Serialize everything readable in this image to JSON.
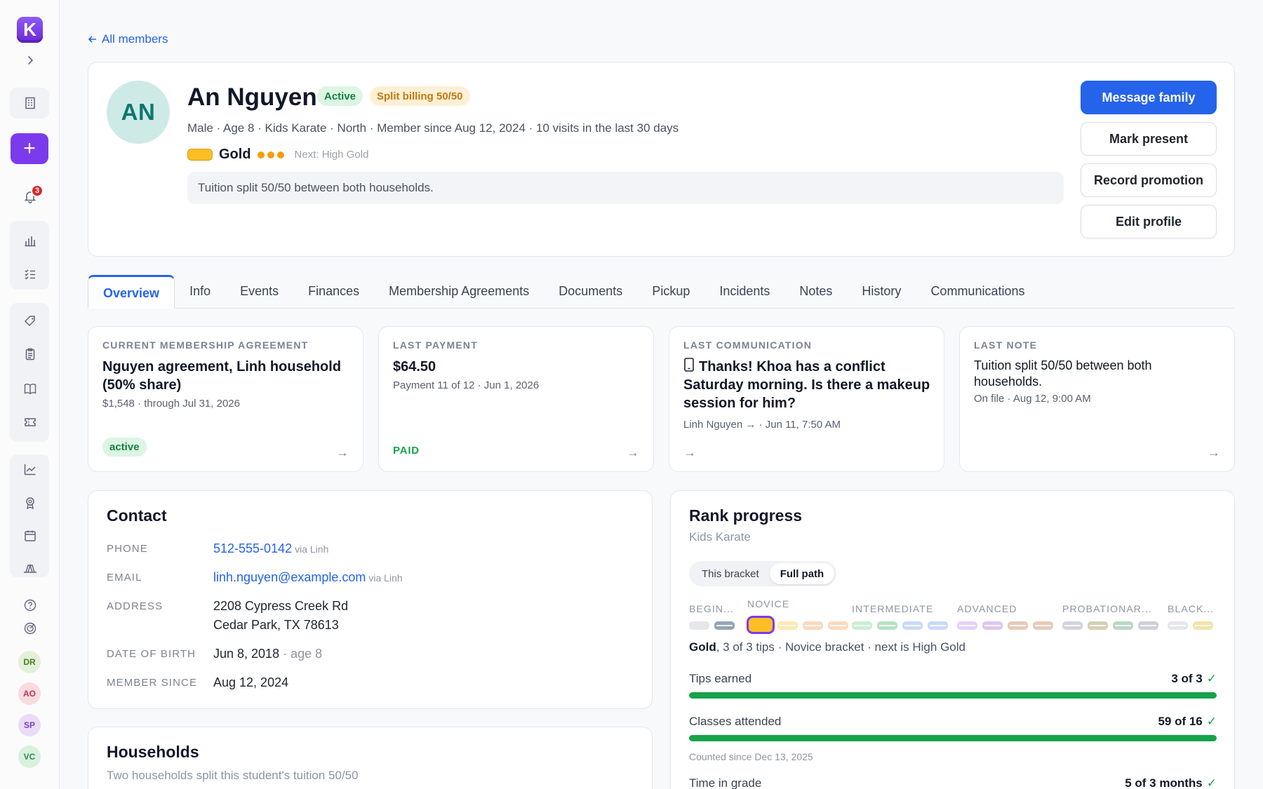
{
  "sidebar": {
    "logo_letter": "K",
    "notifications_count": "3",
    "avatars": [
      {
        "initials": "DR",
        "bg": "#e1f2d8",
        "fg": "#4d7c2a"
      },
      {
        "initials": "AO",
        "bg": "#f9dbe0",
        "fg": "#be3450"
      },
      {
        "initials": "SP",
        "bg": "#eadcf8",
        "fg": "#7e3fc4"
      },
      {
        "initials": "VC",
        "bg": "#d9f1df",
        "fg": "#2f8a4a"
      }
    ]
  },
  "back_link": "All members",
  "profile": {
    "initials": "AN",
    "name": "An Nguyen",
    "status": "Active",
    "billing": "Split billing 50/50",
    "meta": "Male · Age 8 · Kids Karate · North · Member since Aug 12, 2024 · 10 visits in the last 30 days",
    "rank": "Gold",
    "rank_stripes": 3,
    "next_rank": "Next: High Gold",
    "note": "Tuition split 50/50 between both households.",
    "actions": {
      "message": "Message family",
      "present": "Mark present",
      "promotion": "Record promotion",
      "edit": "Edit profile"
    }
  },
  "tabs": [
    "Overview",
    "Info",
    "Events",
    "Finances",
    "Membership Agreements",
    "Documents",
    "Pickup",
    "Incidents",
    "Notes",
    "History",
    "Communications"
  ],
  "summary": {
    "agreement": {
      "label": "CURRENT MEMBERSHIP AGREEMENT",
      "title": "Nguyen agreement, Linh household (50% share)",
      "sub": "$1,548 · through Jul 31, 2026",
      "status": "active"
    },
    "payment": {
      "label": "LAST PAYMENT",
      "title": "$64.50",
      "sub": "Payment 11 of 12 · Jun 1, 2026",
      "status": "PAID"
    },
    "communication": {
      "label": "LAST COMMUNICATION",
      "title": "Thanks! Khoa has a conflict Saturday morning. Is there a makeup session for him?",
      "sub": "Linh Nguyen → · Jun 11, 7:50 AM"
    },
    "note": {
      "label": "LAST NOTE",
      "title": "Tuition split 50/50 between both households.",
      "sub": "On file · Aug 12, 9:00 AM"
    }
  },
  "contact": {
    "title": "Contact",
    "phone_label": "PHONE",
    "phone": "512-555-0142",
    "phone_via": "via Linh",
    "email_label": "EMAIL",
    "email": "linh.nguyen@example.com",
    "email_via": "via Linh",
    "address_label": "ADDRESS",
    "address_line1": "2208 Cypress Creek Rd",
    "address_line2": "Cedar Park, TX 78613",
    "dob_label": "DATE OF BIRTH",
    "dob": "Jun 8, 2018",
    "dob_age": "· age 8",
    "since_label": "MEMBER SINCE",
    "since": "Aug 12, 2024"
  },
  "households": {
    "title": "Households",
    "sub": "Two households split this student's tuition 50/50"
  },
  "rank_progress": {
    "title": "Rank progress",
    "program": "Kids Karate",
    "toggle": [
      "This bracket",
      "Full path"
    ],
    "brackets": [
      "BEGIN...",
      "NOVICE",
      "INTERMEDIATE",
      "ADVANCED",
      "PROBATIONAR...",
      "BLACK..."
    ],
    "belt_colors": {
      "beginner": [
        "#e5e7eb",
        "#94a3b8"
      ],
      "novice": [
        "#fbbf24",
        "#fde9b5",
        "#fcd9bc",
        "#fcd9bc"
      ],
      "intermediate": [
        "#c9efd3",
        "#b5e3c3",
        "#c9daf8",
        "#c9daf8"
      ],
      "advanced": [
        "#e5d2f7",
        "#dcc6f2",
        "#e6cbb8",
        "#e6cbb8"
      ],
      "probationary": [
        "#d1d5db",
        "#d6cfb3",
        "#b9d9c2",
        "#cbd0db"
      ],
      "black": [
        "#e5e7eb",
        "#f2e3a8"
      ]
    },
    "summary_rank": "Gold",
    "summary_rest": ", 3 of 3 tips · Novice bracket · next is High Gold",
    "metrics": [
      {
        "label": "Tips earned",
        "value": "3 of 3",
        "progress": 1.0,
        "note": ""
      },
      {
        "label": "Classes attended",
        "value": "59 of 16",
        "progress": 1.0,
        "note": "Counted since Dec 13, 2025"
      },
      {
        "label": "Time in grade",
        "value": "5 of 3 months",
        "progress": 1.0,
        "note": ""
      }
    ]
  }
}
